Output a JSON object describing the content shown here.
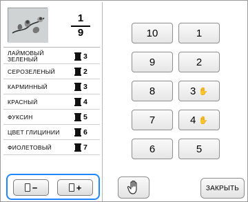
{
  "preview": {
    "current": "1",
    "total": "9"
  },
  "colors": [
    {
      "name": "ЛАЙМОВЫЙ ЗЕЛЕНЫЙ",
      "num": "3",
      "selected": true
    },
    {
      "name": "СЕРОЗЕЛЕНЫЙ",
      "num": "2"
    },
    {
      "name": "КАРМИННЫЙ",
      "num": "3"
    },
    {
      "name": "КРАСНЫЙ",
      "num": "4"
    },
    {
      "name": "ФУКСИН",
      "num": "5"
    },
    {
      "name": "ЦВЕТ ГЛИЦИНИИ",
      "num": "6"
    },
    {
      "name": "ФИОЛЕТОВЫЙ",
      "num": "7"
    }
  ],
  "step": {
    "minus": "−",
    "plus": "+"
  },
  "keys": {
    "k10": "10",
    "k1": "1",
    "k9": "9",
    "k2": "2",
    "k8": "8",
    "k3": "3",
    "k7": "7",
    "k4": "4",
    "k6": "6",
    "k5": "5"
  },
  "close_label": "ЗАКРЫТЬ",
  "icons": {
    "thumb": "flower-embroidery-thumbnail",
    "spool": "thread-spool-icon",
    "hand": "hand-icon",
    "accent": "#1e86ff"
  }
}
